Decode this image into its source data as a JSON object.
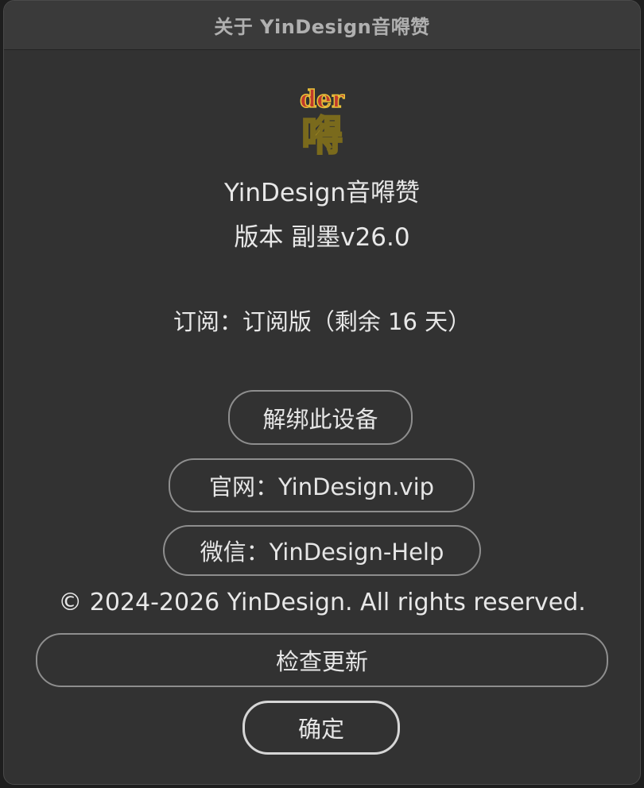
{
  "window": {
    "title": "关于 YinDesign音嘚赞"
  },
  "logo": {
    "top_text": "der",
    "main_char": "嘚",
    "colors": {
      "fill": "#e9c53a",
      "outline": "#7a6a1c",
      "accent": "#c0392b"
    }
  },
  "info": {
    "app_name": "YinDesign音嘚赞",
    "version": "版本 副墨v26.0",
    "subscription": "订阅：订阅版（剩余 16 天）",
    "copyright": "© 2024-2026 YinDesign. All rights reserved."
  },
  "buttons": {
    "unbind": "解绑此设备",
    "website": "官网：YinDesign.vip",
    "wechat": "微信：YinDesign-Help",
    "check_update": "检查更新",
    "ok": "确定"
  }
}
